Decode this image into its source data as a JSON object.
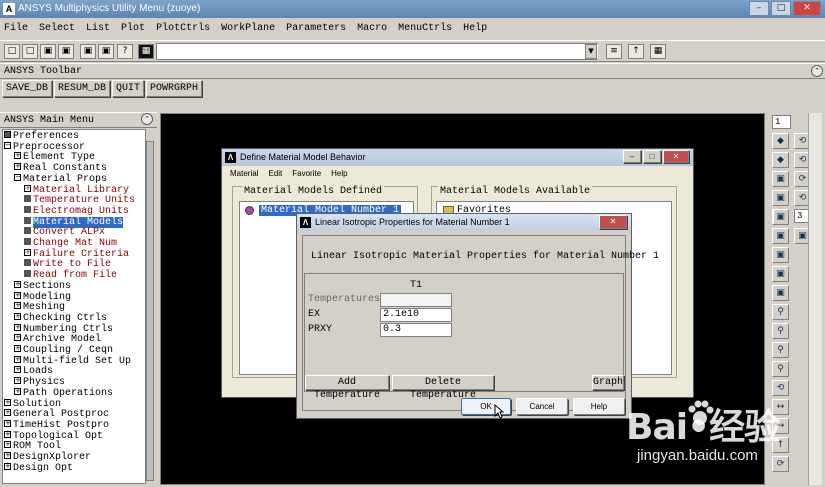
{
  "window": {
    "title": "ANSYS Multiphysics Utility Menu (zuoye)",
    "min_label": "–",
    "max_label": "□",
    "close_label": "✕"
  },
  "menubar": [
    "File",
    "Select",
    "List",
    "Plot",
    "PlotCtrls",
    "WorkPlane",
    "Parameters",
    "Macro",
    "MenuCtrls",
    "Help"
  ],
  "toolbar": {
    "title": "ANSYS Toolbar",
    "buttons": [
      "SAVE_DB",
      "RESUM_DB",
      "QUIT",
      "POWRGRPH"
    ]
  },
  "main_menu": {
    "title": "ANSYS Main Menu",
    "items": [
      {
        "label": "Preferences",
        "mark": "■"
      },
      {
        "label": "Preprocessor",
        "mark": "−"
      },
      {
        "label": "Element Type",
        "mark": "+"
      },
      {
        "label": "Real Constants",
        "mark": "+"
      },
      {
        "label": "Material Props",
        "mark": "−"
      },
      {
        "label": "Material Library",
        "mark": "+"
      },
      {
        "label": "Temperature Units",
        "mark": ""
      },
      {
        "label": "Electromag Units",
        "mark": ""
      },
      {
        "label": "Material Models",
        "mark": ""
      },
      {
        "label": "Convert ALPx",
        "mark": ""
      },
      {
        "label": "Change Mat Num",
        "mark": ""
      },
      {
        "label": "Failure Criteria",
        "mark": "+"
      },
      {
        "label": "Write to File",
        "mark": ""
      },
      {
        "label": "Read from File",
        "mark": ""
      },
      {
        "label": "Sections",
        "mark": "+"
      },
      {
        "label": "Modeling",
        "mark": "+"
      },
      {
        "label": "Meshing",
        "mark": "+"
      },
      {
        "label": "Checking Ctrls",
        "mark": "+"
      },
      {
        "label": "Numbering Ctrls",
        "mark": "+"
      },
      {
        "label": "Archive Model",
        "mark": "+"
      },
      {
        "label": "Coupling / Ceqn",
        "mark": "+"
      },
      {
        "label": "Multi-field Set Up",
        "mark": "+"
      },
      {
        "label": "Loads",
        "mark": "+"
      },
      {
        "label": "Physics",
        "mark": "+"
      },
      {
        "label": "Path Operations",
        "mark": "+"
      },
      {
        "label": "Solution",
        "mark": "+"
      },
      {
        "label": "General Postproc",
        "mark": "+"
      },
      {
        "label": "TimeHist Postpro",
        "mark": "+"
      },
      {
        "label": "Topological Opt",
        "mark": "+"
      },
      {
        "label": "ROM Tool",
        "mark": "+"
      },
      {
        "label": "DesignXplorer",
        "mark": "+"
      },
      {
        "label": "Design Opt",
        "mark": "+"
      }
    ]
  },
  "right_tools": {
    "window_select": "1",
    "view_select": "3"
  },
  "material_dialog": {
    "title": "Define Material Model Behavior",
    "menu": [
      "Material",
      "Edit",
      "Favorite",
      "Help"
    ],
    "defined_label": "Material Models Defined",
    "available_label": "Material Models Available",
    "defined_item": "Material Model Number 1",
    "available_item": "Favorites"
  },
  "iso_dialog": {
    "title": "Linear Isotropic Properties for Material Number 1",
    "heading": "Linear Isotropic Material Properties for Material Number 1",
    "column": "T1",
    "rows": [
      {
        "label": "Temperatures",
        "value": ""
      },
      {
        "label": "EX",
        "value": "2.1e10"
      },
      {
        "label": "PRXY",
        "value": "0.3"
      }
    ],
    "add_temp": "Add Temperature",
    "delete_temp": "Delete Temperature",
    "graph": "Graph",
    "ok": "OK",
    "cancel": "Cancel",
    "help": "Help"
  },
  "watermark": {
    "brand": "Bai•经验",
    "url": "jingyan.baidu.com"
  }
}
